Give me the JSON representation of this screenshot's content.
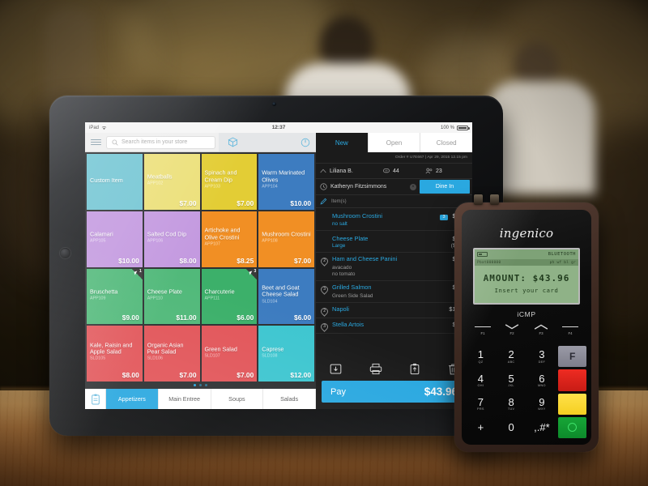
{
  "statusbar": {
    "device": "iPad",
    "wifi_icon": "wifi-icon",
    "time": "12:37",
    "battery_pct": "100 %"
  },
  "search": {
    "menu_icon": "hamburger-menu-icon",
    "search_icon": "search-icon",
    "placeholder": "Search items in your store",
    "cube_icon": "cube-icon",
    "power_icon": "power-icon"
  },
  "grid": {
    "tiles": [
      {
        "name": "Custom Item",
        "sku": "",
        "price": "",
        "color": "#74c6d4",
        "badge": ""
      },
      {
        "name": "Meatballs",
        "sku": "APP102",
        "price": "$7.00",
        "color": "#ece07a",
        "badge": ""
      },
      {
        "name": "Spinach and Cream Dip",
        "sku": "APP103",
        "price": "$7.00",
        "color": "#e3cd35",
        "badge": ""
      },
      {
        "name": "Warm Marinated Olives",
        "sku": "APP104",
        "price": "$10.00",
        "color": "#3d7cc0",
        "badge": ""
      },
      {
        "name": "Calamari",
        "sku": "APP105",
        "price": "$10.00",
        "color": "#c49ae0",
        "badge": ""
      },
      {
        "name": "Salted Cod Dip",
        "sku": "APP106",
        "price": "$8.00",
        "color": "#c49ae0",
        "badge": ""
      },
      {
        "name": "Artichoke and Olive Crostini",
        "sku": "APP107",
        "price": "$8.25",
        "color": "#f18f24",
        "badge": ""
      },
      {
        "name": "Mushroom Crostini",
        "sku": "APP108",
        "price": "$7.00",
        "color": "#f18f24",
        "badge": ""
      },
      {
        "name": "Bruschetta",
        "sku": "APP109",
        "price": "$9.00",
        "color": "#51b97a",
        "badge": "1"
      },
      {
        "name": "Cheese Plate",
        "sku": "APP110",
        "price": "$11.00",
        "color": "#51b97a",
        "badge": ""
      },
      {
        "name": "Charcuterie",
        "sku": "APP111",
        "price": "$6.00",
        "color": "#3cb06a",
        "badge": "3"
      },
      {
        "name": "Beet and Goat Cheese Salad",
        "sku": "SLD104",
        "price": "$6.00",
        "color": "#3d7cc0",
        "badge": ""
      },
      {
        "name": "Kale, Raisin and Apple Salad",
        "sku": "SLD105",
        "price": "$8.00",
        "color": "#e2565a",
        "badge": ""
      },
      {
        "name": "Organic Asian Pear Salad",
        "sku": "SLD106",
        "price": "$7.00",
        "color": "#e2565a",
        "badge": ""
      },
      {
        "name": "Green Salad",
        "sku": "SLD107",
        "price": "$7.00",
        "color": "#e2565a",
        "badge": ""
      },
      {
        "name": "Caprese",
        "sku": "SLD108",
        "price": "$12.00",
        "color": "#3ec6d0",
        "badge": ""
      }
    ]
  },
  "categories": {
    "menu_icon": "menu-board-icon",
    "items": [
      {
        "label": "Appetizers",
        "active": true
      },
      {
        "label": "Main Entree",
        "active": false
      },
      {
        "label": "Soups",
        "active": false
      },
      {
        "label": "Salads",
        "active": false
      }
    ]
  },
  "order": {
    "tabs": [
      {
        "label": "New",
        "active": true
      },
      {
        "label": "Open",
        "active": false
      },
      {
        "label": "Closed",
        "active": false
      }
    ],
    "meta": "Order # U7E667   |   Apr 29, 2015 12.15 pm",
    "server_icon": "cloud-icon",
    "server": "Liliana B.",
    "table_icon": "table-icon",
    "table": "44",
    "guests_icon": "guests-icon",
    "guests": "23",
    "customer_icon": "clock-icon",
    "customer": "Katheryn Fitzsimmons",
    "clear_icon": "clear-x-icon",
    "dine_in_label": "Dine In",
    "note_icon": "pencil-icon",
    "note_label": "Item(s)",
    "items": [
      {
        "qty": "",
        "name": "Mushroom Crostini",
        "badge": "3",
        "price": "$6.00",
        "mods": [
          {
            "label": "no salt",
            "value": "",
            "accent": true
          }
        ]
      },
      {
        "qty": "",
        "name": "Cheese Plate",
        "badge": "",
        "price": "$6.00",
        "mods": [
          {
            "label": "Large",
            "value": "($2.00)",
            "accent": true
          }
        ]
      },
      {
        "qty": "2",
        "name": "Ham and Cheese Panini",
        "badge": "",
        "price": "$4.00",
        "mods": [
          {
            "label": "avacado",
            "value": "–",
            "accent": false
          },
          {
            "label": "no tomato",
            "value": "–",
            "accent": false
          }
        ]
      },
      {
        "qty": "3",
        "name": "Grilled Salmon",
        "badge": "",
        "price": "$6.00",
        "mods": [
          {
            "label": "Green Side Salad",
            "value": "–",
            "accent": false
          }
        ]
      },
      {
        "qty": "2",
        "name": "Napoli",
        "badge": "",
        "price": "$14.95",
        "mods": []
      },
      {
        "qty": "3",
        "name": "Stella Artois",
        "badge": "",
        "price": "$8.00",
        "mods": []
      }
    ],
    "actions": [
      {
        "icon": "save-to-folder-icon",
        "name": "save-order"
      },
      {
        "icon": "printer-icon",
        "name": "print-order"
      },
      {
        "icon": "send-receipt-icon",
        "name": "send-receipt"
      },
      {
        "icon": "trash-icon",
        "name": "delete-order"
      }
    ],
    "pay_label": "Pay",
    "pay_amount": "$43.96"
  },
  "terminal": {
    "brand": "ingenico",
    "model": "iCMP",
    "lcd": {
      "bluetooth": "BLUETOOTH",
      "statusline": "Pbat000000",
      "statusline_right": "ph wf bl gr",
      "amount": "AMOUNT: $43.96",
      "prompt": "Insert your card"
    },
    "function_keys": [
      {
        "label": "F1",
        "glyph": "line"
      },
      {
        "label": "F2",
        "glyph": "down"
      },
      {
        "label": "F3",
        "glyph": "up"
      },
      {
        "label": "F4",
        "glyph": "line"
      }
    ],
    "keypad": [
      {
        "digit": "1",
        "sub": "QZ"
      },
      {
        "digit": "2",
        "sub": "ABC"
      },
      {
        "digit": "3",
        "sub": "DEF"
      },
      {
        "digit": "4",
        "sub": "GHI"
      },
      {
        "digit": "5",
        "sub": "JKL"
      },
      {
        "digit": "6",
        "sub": "MNO"
      },
      {
        "digit": "7",
        "sub": "PRS"
      },
      {
        "digit": "8",
        "sub": "TUV"
      },
      {
        "digit": "9",
        "sub": "WXY"
      },
      {
        "digit": "+",
        "sub": ""
      },
      {
        "digit": "0",
        "sub": ""
      },
      {
        "digit": ",.#*",
        "sub": ""
      }
    ],
    "control_keys": [
      {
        "name": "function-key",
        "color": "#8a8a96",
        "symbol": "F"
      },
      {
        "name": "cancel-key",
        "color": "#e02a22",
        "symbol": ""
      },
      {
        "name": "correct-key",
        "color": "#f5cf21",
        "symbol": ""
      },
      {
        "name": "enter-key",
        "color": "#0d8a2b",
        "symbol": ""
      }
    ]
  },
  "colors": {
    "accent": "#2aa8e0",
    "panel_dark": "#1b1b1b",
    "ipad_bezel": "#141517"
  }
}
